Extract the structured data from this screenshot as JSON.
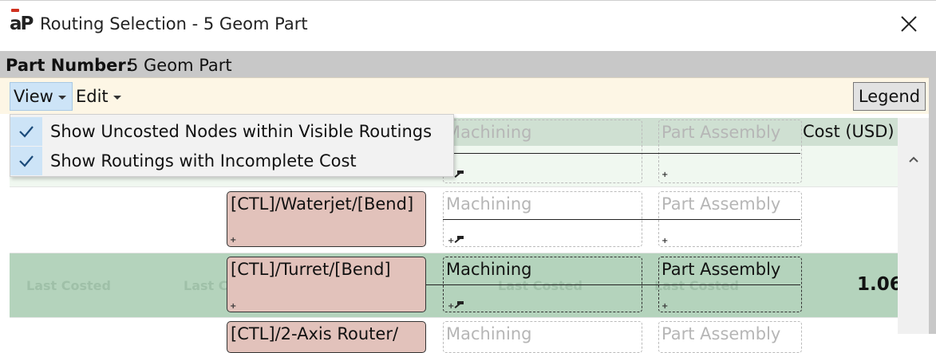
{
  "window": {
    "logo_text": "aP",
    "title": "Routing Selection - 5 Geom Part",
    "close_icon": "close-icon"
  },
  "part": {
    "label": "Part Number:",
    "value": "5 Geom Part"
  },
  "toolbar": {
    "view_label": "View",
    "edit_label": "Edit",
    "legend_label": "Legend"
  },
  "view_menu": {
    "items": [
      {
        "label": "Show Uncosted Nodes within Visible Routings",
        "checked": true,
        "icon": "check-icon"
      },
      {
        "label": "Show Routings with Incomplete Cost",
        "checked": true,
        "icon": "check-icon"
      }
    ]
  },
  "grid": {
    "cost_header": "Cost (USD)",
    "rows": [
      {
        "route": "",
        "step2": "Machining",
        "step3": "Part Assembly",
        "cost": ""
      },
      {
        "route": "[CTL]/Waterjet/[Bend]",
        "step2": "Machining",
        "step3": "Part Assembly",
        "cost": ""
      },
      {
        "route": "[CTL]/Turret/[Bend]",
        "step2": "Machining",
        "step3": "Part Assembly",
        "cost": "1.06",
        "ghost": [
          "Last Costed",
          "Last C",
          "Last Costed",
          "Last Costed"
        ]
      },
      {
        "route": "[CTL]/2-Axis Router/",
        "step2": "Machining",
        "step3": "Part Assembly",
        "cost": ""
      }
    ]
  },
  "colors": {
    "selected_row": "#b4d3bc",
    "route_node": "#e2c2bb",
    "header": "#cfe0d2",
    "toolbar": "#fdf6e5",
    "menu_highlight": "#cde4f7",
    "logo_accent": "#d0311f"
  }
}
